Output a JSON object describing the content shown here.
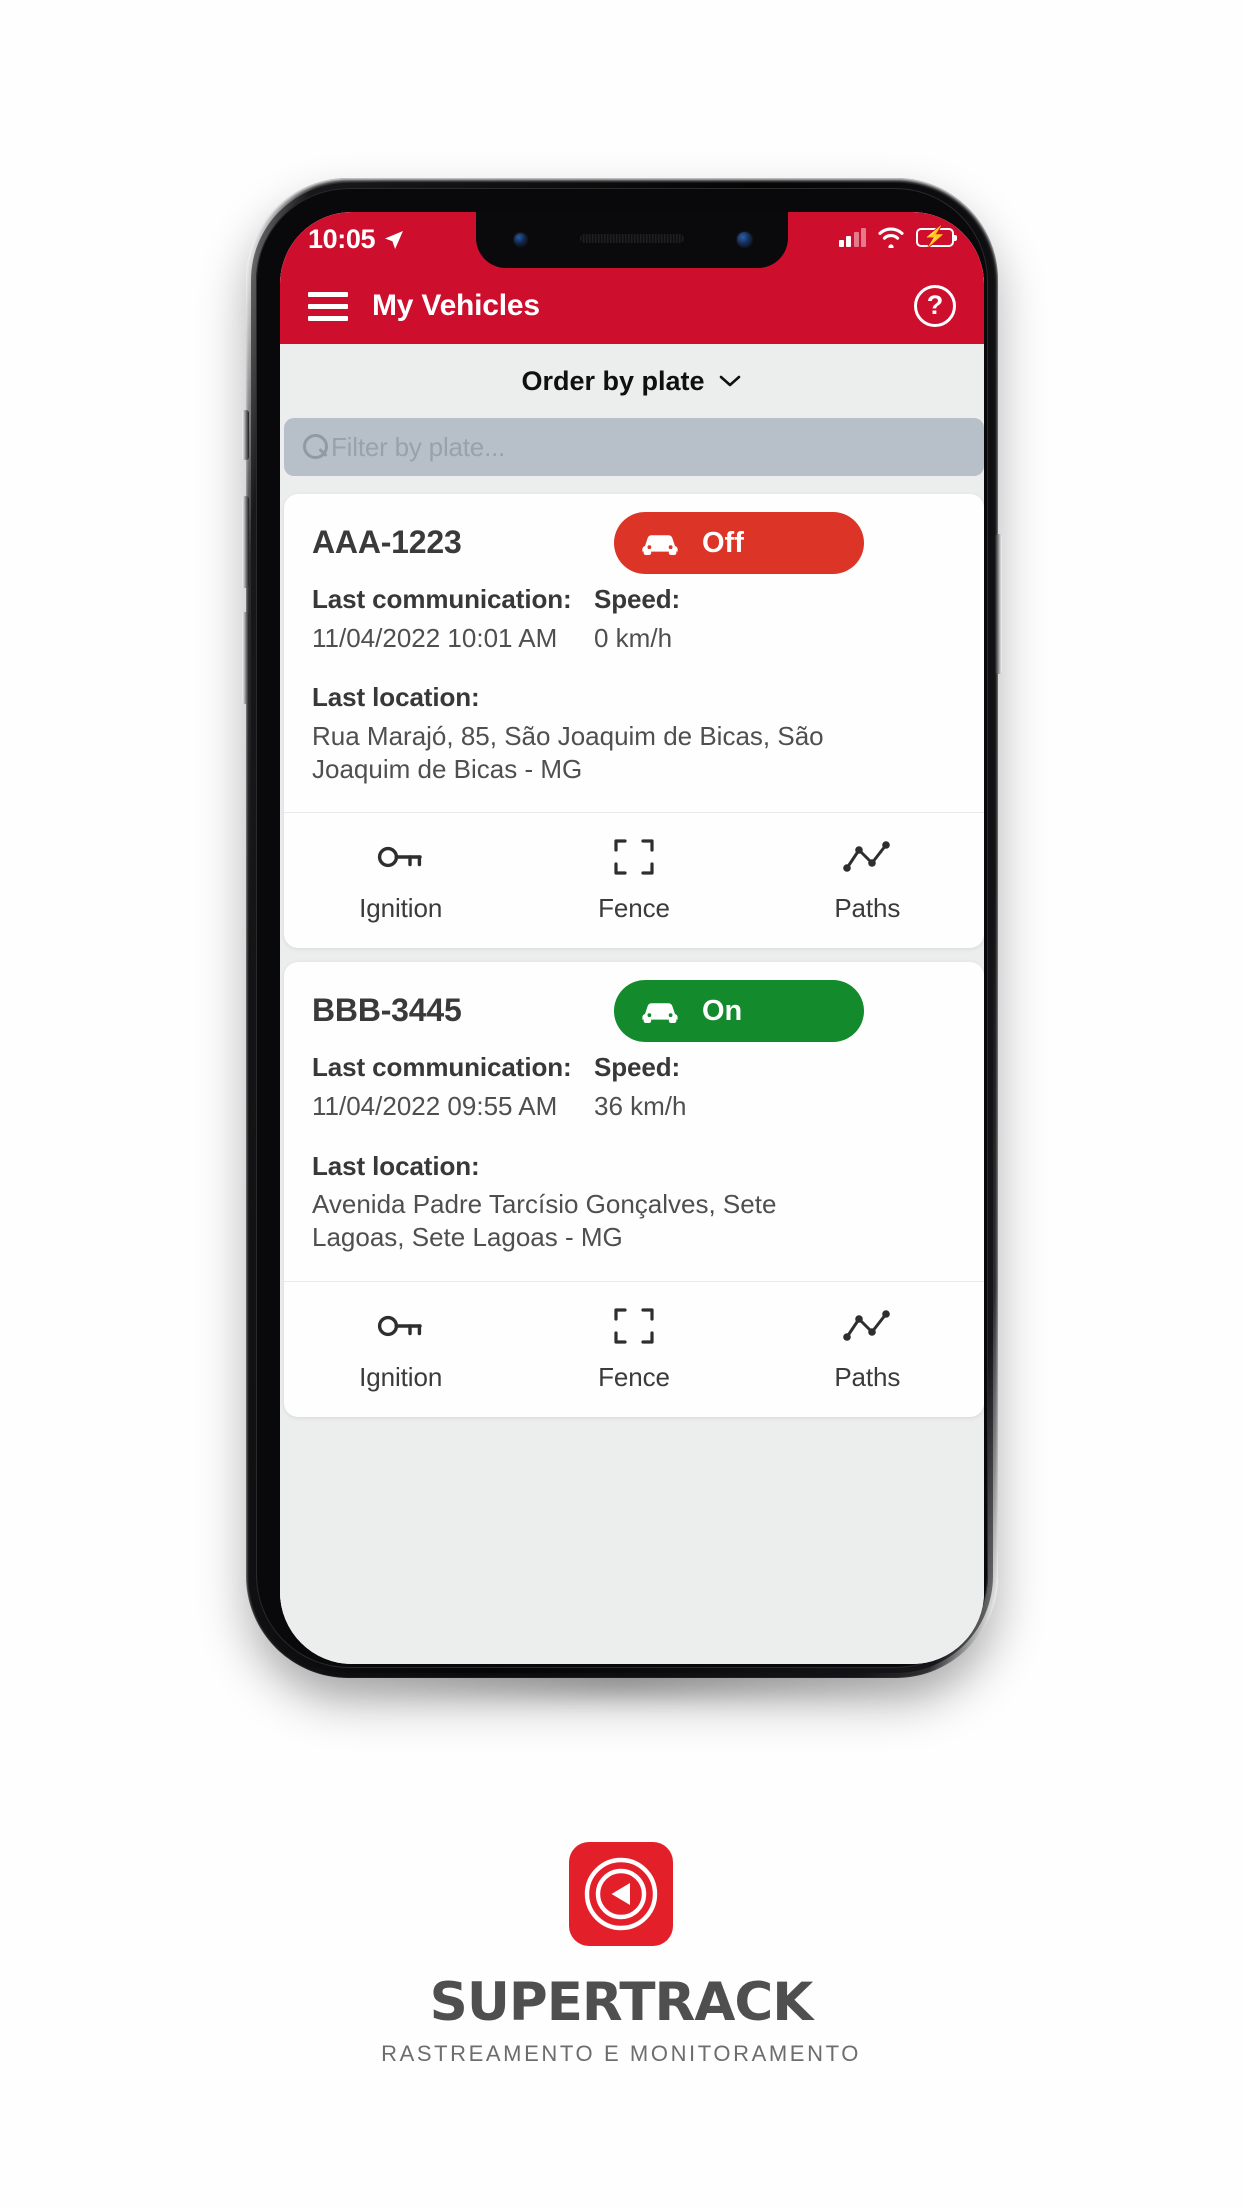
{
  "status_bar": {
    "time": "10:05",
    "location_arrow_icon": "location-arrow-icon",
    "signal_icon": "cellular-signal-icon",
    "wifi_icon": "wifi-icon",
    "battery_icon": "battery-charging-icon"
  },
  "app_bar": {
    "menu_icon": "hamburger-menu-icon",
    "title": "My Vehicles",
    "help_icon": "help-circle-icon",
    "help_glyph": "?"
  },
  "sort": {
    "label": "Order by plate",
    "chevron_glyph": "⌄",
    "chevron_icon": "chevron-down-icon"
  },
  "search": {
    "placeholder": "Filter by plate...",
    "value": "",
    "icon": "search-icon"
  },
  "colors": {
    "brand_red": "#ce0e2d",
    "badge_off_red": "#dc3427",
    "badge_on_green": "#138a2b",
    "logo_red": "#e3202a",
    "search_field": "#b7c0c8",
    "page_background": "#eceded"
  },
  "labels": {
    "last_communication": "Last communication:",
    "speed": "Speed:",
    "last_location": "Last location:"
  },
  "actions": [
    {
      "label": "Ignition",
      "icon": "key-icon"
    },
    {
      "label": "Fence",
      "icon": "geofence-brackets-icon"
    },
    {
      "label": "Paths",
      "icon": "route-line-chart-icon"
    }
  ],
  "vehicles": [
    {
      "plate": "AAA-1223",
      "status": "Off",
      "status_state": "off",
      "status_icon": "car-icon",
      "last_communication": "11/04/2022 10:01 AM",
      "speed": "0 km/h",
      "last_location": "Rua Marajó, 85, São Joaquim de Bicas, São Joaquim de Bicas - MG"
    },
    {
      "plate": "BBB-3445",
      "status": "On",
      "status_state": "on",
      "status_icon": "car-icon",
      "last_communication": "11/04/2022 09:55 AM",
      "speed": "36 km/h",
      "last_location": "Avenida Padre Tarcísio Gonçalves, Sete Lagoas, Sete Lagoas - MG"
    }
  ],
  "brand": {
    "name": "SUPERTRACK",
    "tagline": "RASTREAMENTO E MONITORAMENTO",
    "logo_icon": "supertrack-radar-cursor-logo"
  }
}
